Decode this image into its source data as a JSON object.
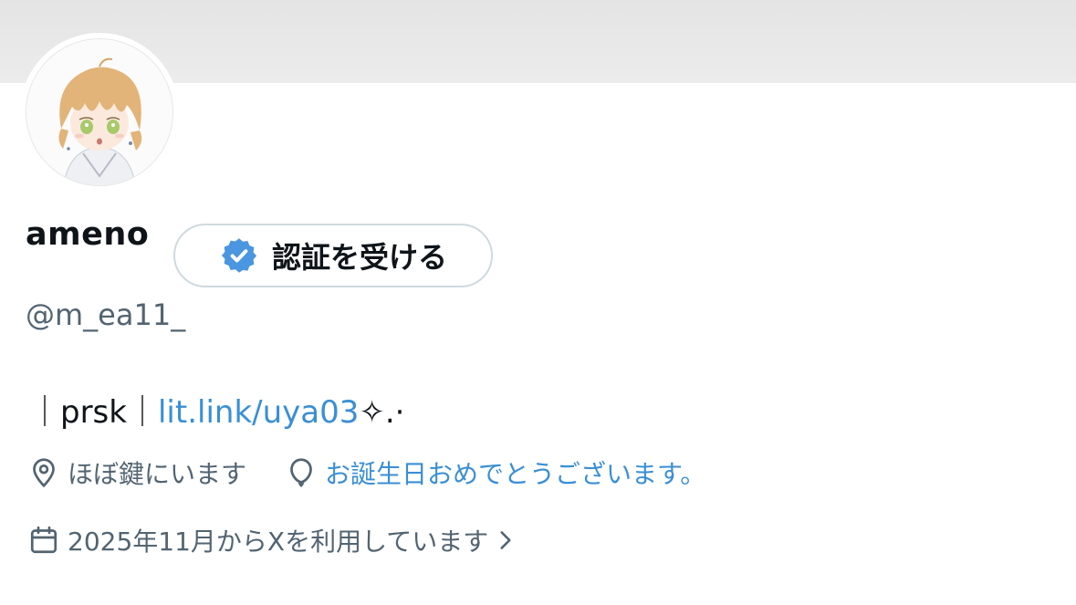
{
  "profile": {
    "display_name": "ameno",
    "handle": "@m_ea11_",
    "verify_button_label": "認証を受ける",
    "bio": {
      "prefix": "｜prsk｜",
      "link": "lit.link/uya03",
      "suffix": "✧.·"
    },
    "location": "ほぼ鍵にいます",
    "birthday_text": "お誕生日おめでとうございます。",
    "joined_text": "2025年11月からXを利用しています"
  },
  "colors": {
    "accent": "#3a8fd4",
    "text": "#0f1419",
    "muted": "#536471",
    "verified_badge": "#4a96e0"
  },
  "icons": {
    "verify": "verified-badge-icon",
    "location": "location-pin-icon",
    "birthday": "balloon-icon",
    "joined": "calendar-icon",
    "chevron": "chevron-right-icon"
  }
}
